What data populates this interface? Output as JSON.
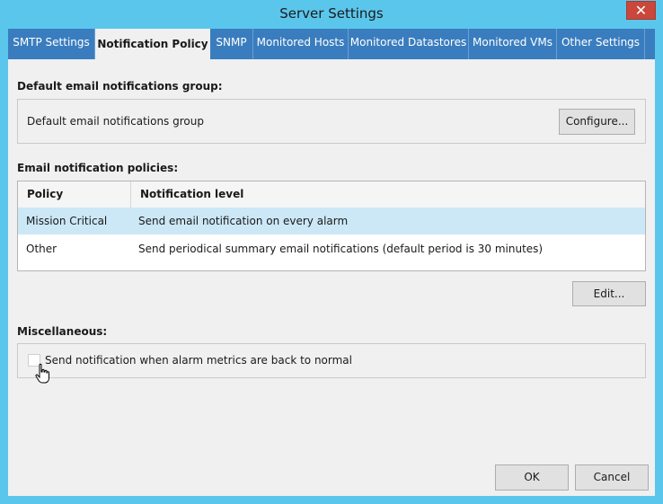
{
  "window": {
    "title": "Server Settings",
    "close_glyph": "✕"
  },
  "tabs": [
    {
      "label": "SMTP Settings"
    },
    {
      "label": "Notification Policy"
    },
    {
      "label": "SNMP"
    },
    {
      "label": "Monitored Hosts"
    },
    {
      "label": "Monitored Datastores"
    },
    {
      "label": "Monitored VMs"
    },
    {
      "label": "Other Settings"
    }
  ],
  "default_group": {
    "heading": "Default email notifications group:",
    "text": "Default email notifications group",
    "configure_label": "Configure..."
  },
  "policies": {
    "heading": "Email notification policies:",
    "columns": [
      "Policy",
      "Notification level"
    ],
    "rows": [
      {
        "policy": "Mission Critical",
        "level": "Send email notification on every alarm",
        "selected": true
      },
      {
        "policy": "Other",
        "level": "Send periodical summary email notifications (default period is 30 minutes)",
        "selected": false
      }
    ],
    "edit_label": "Edit..."
  },
  "misc": {
    "heading": "Miscellaneous:",
    "checkbox_label": "Send notification when alarm metrics are back to normal",
    "checked": false
  },
  "footer": {
    "ok_label": "OK",
    "cancel_label": "Cancel"
  },
  "colors": {
    "titlebar": "#5bc6ec",
    "tabstrip": "#3a7dbf",
    "selected_row": "#cce8f7",
    "close": "#c9473b"
  }
}
